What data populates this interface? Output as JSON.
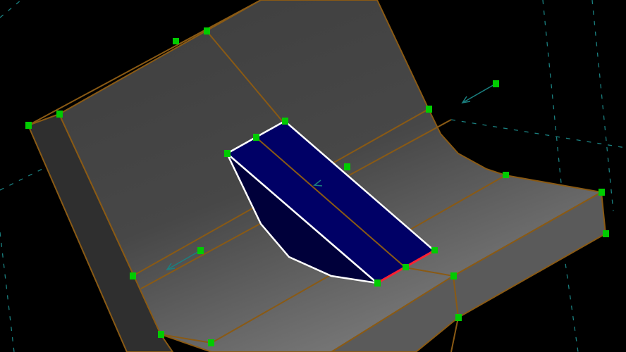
{
  "viewport": {
    "colors": {
      "background": "#000000",
      "surface_top": "#3e3e3e",
      "surface_bottom": "#7a7a7a",
      "side_face": "#2f2f2f",
      "front_face": "#5a5a5a",
      "edge": "#8a5a14",
      "selected_face": "#000066",
      "selected_side": "#00003a",
      "selected_outline": "#ffffff",
      "highlight_edge": "#ff2030",
      "vertex_marker": "#00cc00",
      "axis_line": "#1a8080"
    }
  }
}
